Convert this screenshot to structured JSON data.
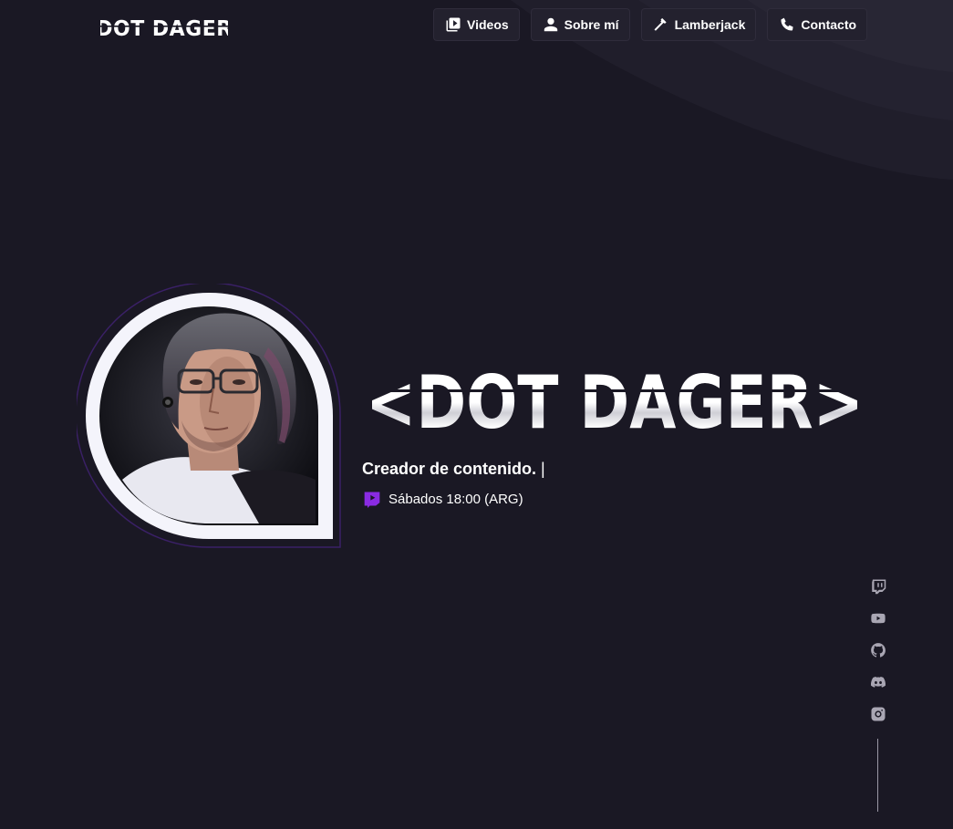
{
  "header": {
    "logo_text": "<DOT DAGER>",
    "nav": [
      {
        "label": "Videos",
        "icon": "video-library-icon"
      },
      {
        "label": "Sobre mí",
        "icon": "user-icon"
      },
      {
        "label": "Lamberjack",
        "icon": "hammer-icon"
      },
      {
        "label": "Contacto",
        "icon": "phone-icon"
      }
    ]
  },
  "hero": {
    "title": "<DOT DAGER>",
    "tagline": "Creador de contenido.",
    "cursor": "|",
    "schedule": "Sábados 18:00 (ARG)",
    "schedule_icon": "twitch-live-icon"
  },
  "social": [
    {
      "name": "twitch-icon"
    },
    {
      "name": "youtube-icon"
    },
    {
      "name": "github-icon"
    },
    {
      "name": "discord-icon"
    },
    {
      "name": "instagram-icon"
    }
  ],
  "colors": {
    "background": "#1a1824",
    "accent": "#8a2be2",
    "nav_bg": "#23212e",
    "icon_muted": "#a9a6b3"
  }
}
